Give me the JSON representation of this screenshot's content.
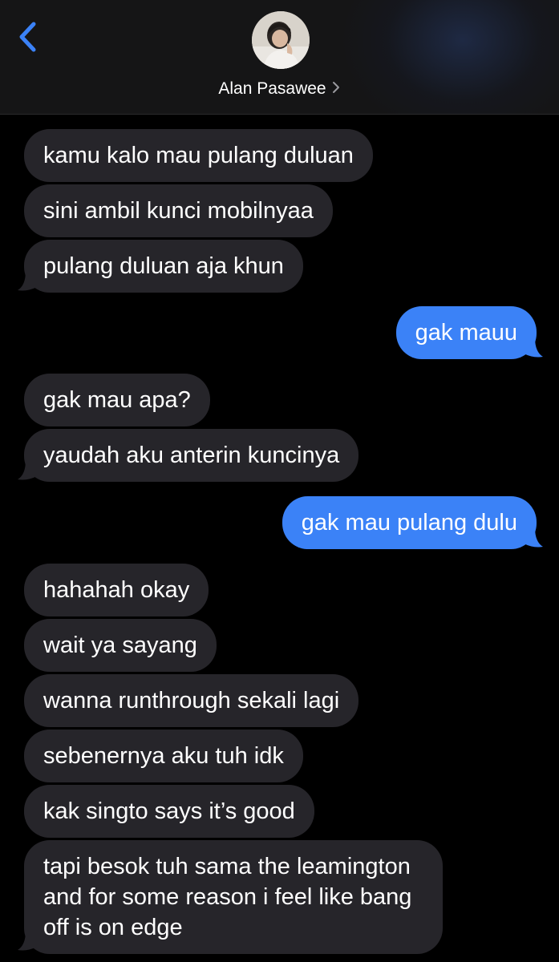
{
  "header": {
    "contact_name": "Alan Pasawee",
    "back_icon": "chevron-left-icon",
    "chevron_icon": "chevron-right-icon",
    "accent_color": "#3b82f7"
  },
  "messages": [
    {
      "side": "in",
      "text": "kamu kalo mau pulang duluan"
    },
    {
      "side": "in",
      "text": "sini ambil kunci mobilnyaa"
    },
    {
      "side": "in",
      "text": "pulang duluan aja khun"
    },
    {
      "side": "out",
      "text": "gak mauu"
    },
    {
      "side": "in",
      "text": "gak mau apa?"
    },
    {
      "side": "in",
      "text": "yaudah aku anterin kuncinya"
    },
    {
      "side": "out",
      "text": "gak mau pulang dulu"
    },
    {
      "side": "in",
      "text": "hahahah okay"
    },
    {
      "side": "in",
      "text": "wait ya sayang"
    },
    {
      "side": "in",
      "text": "wanna runthrough sekali lagi"
    },
    {
      "side": "in",
      "text": "sebenernya aku tuh idk"
    },
    {
      "side": "in",
      "text": "kak singto says it’s good"
    },
    {
      "side": "in",
      "text": "tapi besok tuh sama the leamington and for some reason i feel like bang off is on edge"
    }
  ]
}
